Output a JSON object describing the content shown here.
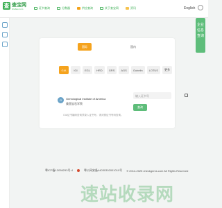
{
  "header": {
    "logo_char": "查",
    "logo_text": "查宝网",
    "logo_sub": "chabao.com",
    "nav": [
      "证书查询",
      "分数器",
      "供应查询",
      "关于查宝网",
      "资讯"
    ],
    "lang": "English"
  },
  "float_panel": {
    "label": "企业信息查询"
  },
  "card": {
    "toggle_main": "国际",
    "toggle_alt": "国内",
    "chips": [
      "GIA",
      "IGI",
      "EGL",
      "HRD",
      "GRS",
      "AGS",
      "Gubelin",
      "LOTUS",
      "更多"
    ],
    "org_badge": "G",
    "org_name": "Gemological Institute of America",
    "org_sub": "美国宝石学院",
    "hint": "GIA证书编码查询须录入证书号，请对照证书号码查询。",
    "input_placeholder": "输入证书号",
    "query_button": "查询"
  },
  "footer": {
    "icp": "粤ICP备13056293号-4",
    "police": "粤公网安备44030302001010号",
    "copyright": "© 2014-2025 checkgems.com All Rights Reserved"
  },
  "watermark": "速站收录网"
}
